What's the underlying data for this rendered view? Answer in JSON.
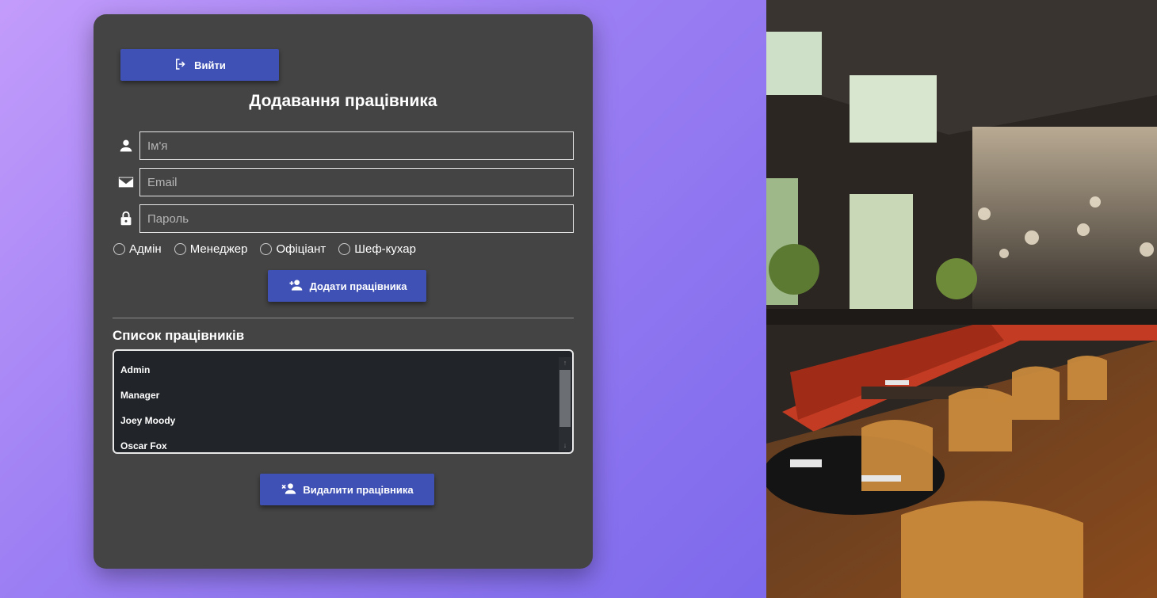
{
  "buttons": {
    "logout": "Вийти",
    "add_employee": "Додати працівника",
    "delete_employee": "Видалити працівника"
  },
  "form": {
    "title": "Додавання працівника",
    "name_placeholder": "Ім'я",
    "email_placeholder": "Email",
    "password_placeholder": "Пароль"
  },
  "roles": [
    "Адмін",
    "Менеджер",
    "Офіціант",
    "Шеф-кухар"
  ],
  "employees": {
    "title": "Список працівників",
    "items": [
      "Admin",
      "Manager",
      "Joey Moody",
      "Oscar Fox"
    ]
  },
  "icons": {
    "logout": "logout-icon",
    "name": "person-icon",
    "email": "envelope-icon",
    "password": "lock-icon",
    "add": "person-add-icon",
    "delete": "person-remove-icon"
  },
  "colors": {
    "background_gradient_start": "#c39cfb",
    "background_gradient_end": "#6e5fe8",
    "panel": "#444444",
    "accent": "#3f51b5",
    "list_bg": "#212529"
  }
}
